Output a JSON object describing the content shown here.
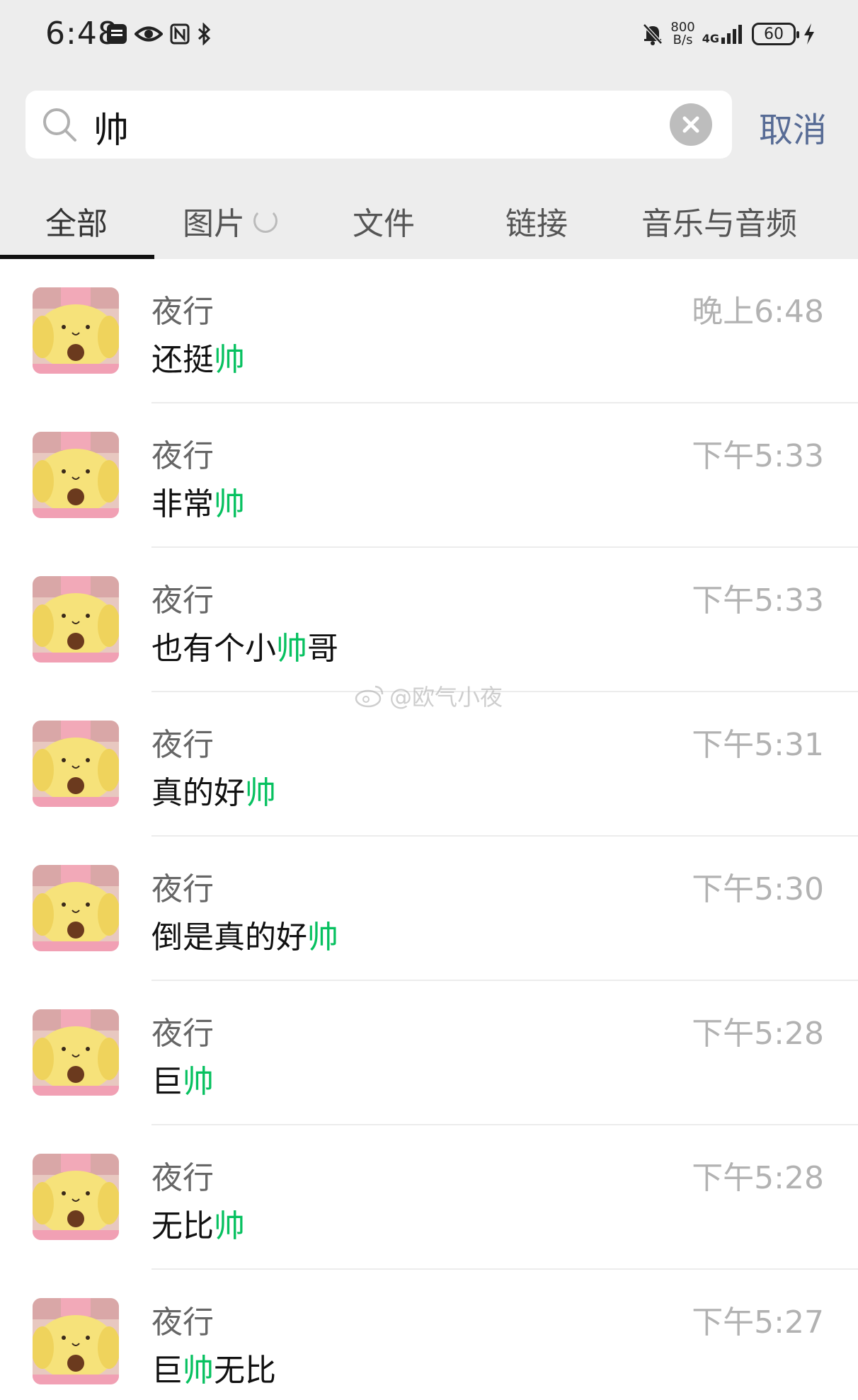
{
  "status_bar": {
    "time": "6:48",
    "net_speed_value": "800",
    "net_speed_unit": "B/s",
    "network_type": "4G",
    "battery": "60",
    "left_icons": [
      "app-badge-icon",
      "eye-icon",
      "nfc-icon",
      "bluetooth-icon"
    ],
    "right_icons": [
      "mute-bell-icon",
      "signal-icon",
      "charging-icon"
    ]
  },
  "search": {
    "query": "帅",
    "cancel_label": "取消"
  },
  "tabs": [
    {
      "label": "全部",
      "active": true
    },
    {
      "label": "图片",
      "loading": true
    },
    {
      "label": "文件"
    },
    {
      "label": "链接"
    },
    {
      "label": "音乐与音频"
    }
  ],
  "results": [
    {
      "sender": "夜行",
      "time": "晚上6:48",
      "before": "还挺",
      "match": "帅",
      "after": ""
    },
    {
      "sender": "夜行",
      "time": "下午5:33",
      "before": "非常",
      "match": "帅",
      "after": ""
    },
    {
      "sender": "夜行",
      "time": "下午5:33",
      "before": "也有个小",
      "match": "帅",
      "after": "哥"
    },
    {
      "sender": "夜行",
      "time": "下午5:31",
      "before": "真的好",
      "match": "帅",
      "after": ""
    },
    {
      "sender": "夜行",
      "time": "下午5:30",
      "before": "倒是真的好",
      "match": "帅",
      "after": ""
    },
    {
      "sender": "夜行",
      "time": "下午5:28",
      "before": "巨",
      "match": "帅",
      "after": ""
    },
    {
      "sender": "夜行",
      "time": "下午5:28",
      "before": "无比",
      "match": "帅",
      "after": ""
    },
    {
      "sender": "夜行",
      "time": "下午5:27",
      "before": "巨",
      "match": "帅",
      "after": "无比"
    }
  ],
  "watermark": "@欧气小夜",
  "colors": {
    "header_bg": "#ededed",
    "highlight": "#07c160",
    "link": "#576b95",
    "time_gray": "#b2b2b2"
  }
}
